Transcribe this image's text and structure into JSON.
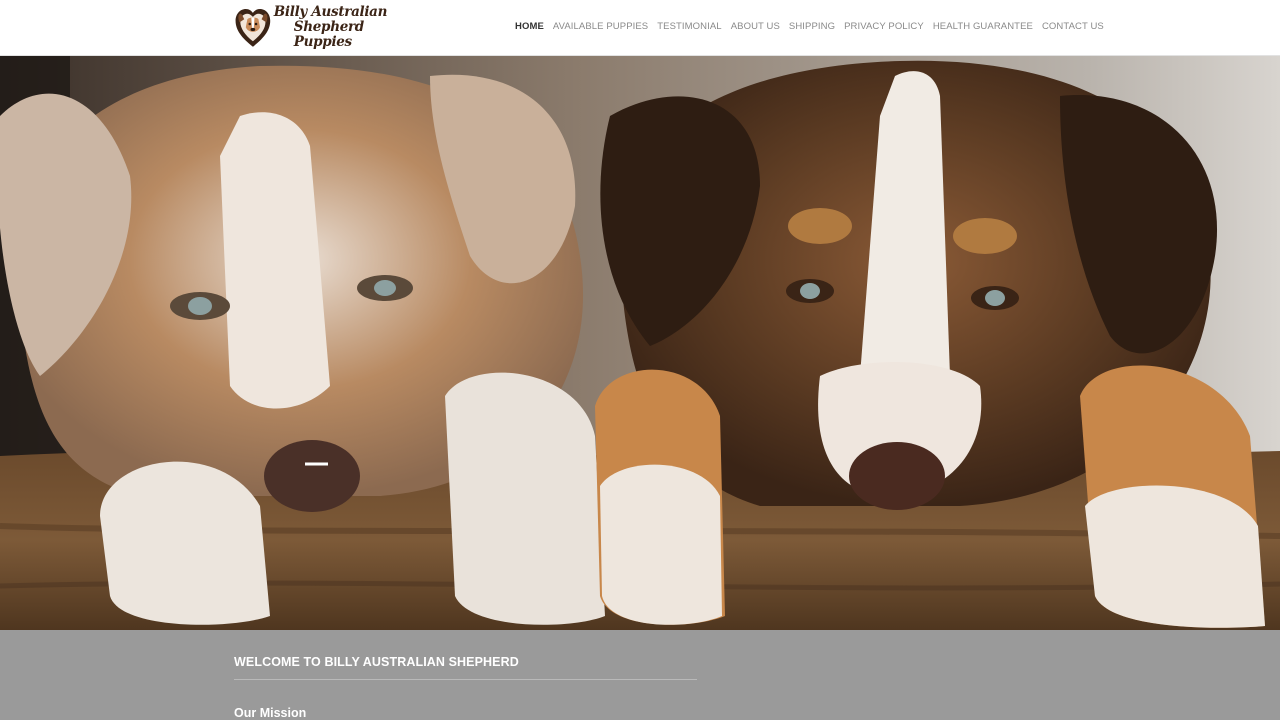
{
  "header": {
    "logo": {
      "line1": "Billy Australian",
      "line2": "Shepherd Puppies"
    },
    "nav": [
      {
        "label": "HOME",
        "active": true
      },
      {
        "label": "AVAILABLE PUPPIES",
        "active": false
      },
      {
        "label": "TESTIMONIAL",
        "active": false
      },
      {
        "label": "ABOUT US",
        "active": false
      },
      {
        "label": "SHIPPING",
        "active": false
      },
      {
        "label": "PRIVACY POLICY",
        "active": false
      },
      {
        "label": "HEALTH GUARANTEE",
        "active": false
      },
      {
        "label": "CONTACT US",
        "active": false
      }
    ]
  },
  "hero": {
    "image_subject": "two australian shepherd puppies resting paws on a wooden log",
    "slides_total": 2,
    "active_slide": 1
  },
  "welcome": {
    "title": "WELCOME TO BILLY AUSTRALIAN SHEPHERD",
    "subtitle": "Our Mission"
  },
  "colors": {
    "header_bg": "#ffffff",
    "nav_text": "#8a8a8a",
    "nav_active": "#333333",
    "section_bg": "#9a9a9a",
    "logo_brown": "#3b2416"
  }
}
